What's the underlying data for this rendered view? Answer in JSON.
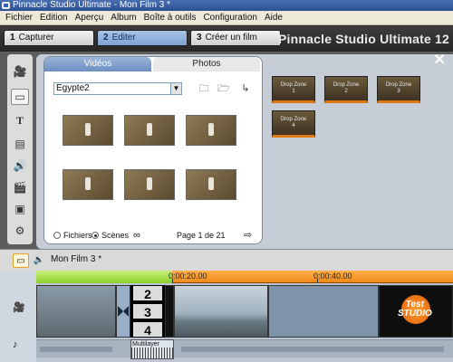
{
  "window": {
    "title": "Pinnacle Studio Ultimate - Mon Film 3 *"
  },
  "menu": [
    "Fichier",
    "Edition",
    "Aperçu",
    "Album",
    "Boîte à outils",
    "Configuration",
    "Aide"
  ],
  "steps": [
    {
      "num": "1",
      "label": "Capturer"
    },
    {
      "num": "2",
      "label": "Editer"
    },
    {
      "num": "3",
      "label": "Créer un film"
    }
  ],
  "brand": "Pinnacle Studio Ultimate 12",
  "album": {
    "tabs": {
      "videos": "Vidéos",
      "photos": "Photos"
    },
    "selected_album": "Egypte2",
    "page_text": "Page 1 de 21",
    "radio": {
      "files": "Fichiers",
      "scenes": "Scènes"
    }
  },
  "dropzones": [
    {
      "line1": "Drop Zone",
      "line2": "1"
    },
    {
      "line1": "Drop Zone",
      "line2": "2"
    },
    {
      "line1": "Drop Zone",
      "line2": "3"
    },
    {
      "line1": "Drop Zone",
      "line2": "4"
    }
  ],
  "timeline": {
    "movie_title": "Mon Film 3 *",
    "ruler": [
      "0:00:20.00",
      "0:00:40.00"
    ],
    "countdown": [
      "2",
      "3",
      "4"
    ],
    "logo_line1": "Test",
    "logo_line2": "STUDIO",
    "audio_label": "Multilayer"
  },
  "colors": {
    "accent_orange": "#f08a1a",
    "accent_green": "#8ccf2a",
    "tab_blue": "#7ea2d3"
  }
}
